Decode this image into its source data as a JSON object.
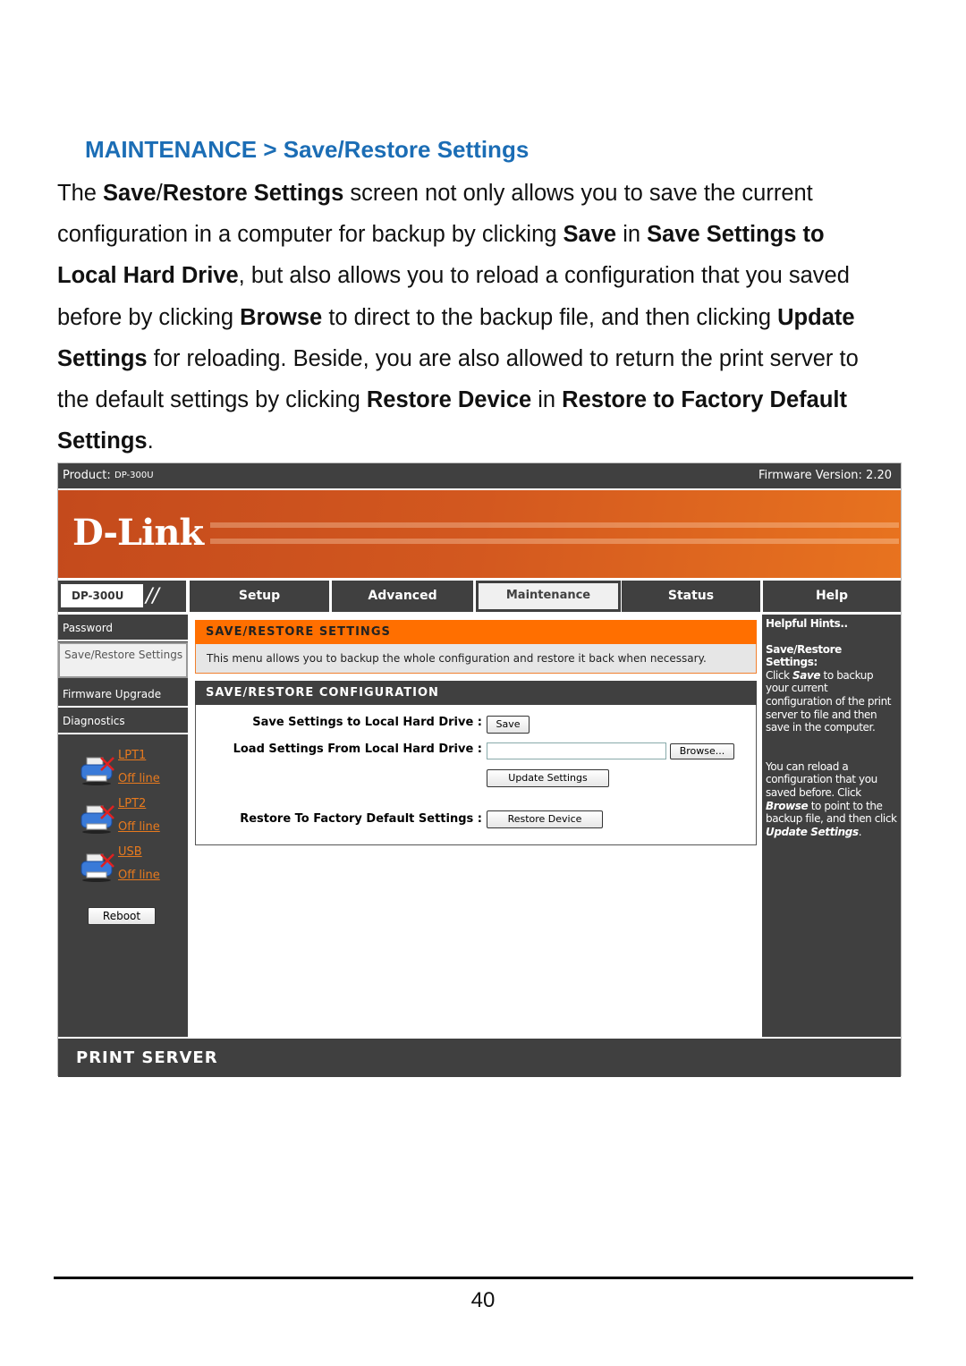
{
  "heading": "MAINTENANCE > Save/Restore Settings",
  "paragraph": [
    {
      "t": "The ",
      "b": false
    },
    {
      "t": "Save",
      "b": true
    },
    {
      "t": "/",
      "b": false
    },
    {
      "t": "Restore Settings",
      "b": true
    },
    {
      "t": " screen not only allows you to save the current configuration in a computer for backup by clicking ",
      "b": false
    },
    {
      "t": "Save",
      "b": true
    },
    {
      "t": " in ",
      "b": false
    },
    {
      "t": "Save Settings to Local Hard Drive",
      "b": true
    },
    {
      "t": ", but also allows you to reload a configuration that you saved before by clicking ",
      "b": false
    },
    {
      "t": "Browse",
      "b": true
    },
    {
      "t": " to direct to the backup file, and then clicking ",
      "b": false
    },
    {
      "t": "Update Settings",
      "b": true
    },
    {
      "t": " for reloading. Beside, you are also allowed to return the print server to the default settings by clicking ",
      "b": false
    },
    {
      "t": "Restore Device",
      "b": true
    },
    {
      "t": " in ",
      "b": false
    },
    {
      "t": "Restore to Factory Default Settings",
      "b": true
    },
    {
      "t": ".",
      "b": false
    }
  ],
  "screenshot": {
    "product_label": "Product:",
    "product": "DP-300U",
    "firmware": "Firmware Version: 2.20",
    "logo": "D-Link",
    "model_tab": "DP-300U",
    "tabs": [
      "Setup",
      "Advanced",
      "Maintenance",
      "Status",
      "Help"
    ],
    "active_tab": "Maintenance",
    "sidebar": [
      "Password",
      "Save/Restore Settings",
      "Firmware Upgrade",
      "Diagnostics"
    ],
    "ports": [
      {
        "name": "LPT1",
        "status": "Off line"
      },
      {
        "name": "LPT2",
        "status": "Off line"
      },
      {
        "name": "USB",
        "status": "Off line"
      }
    ],
    "reboot": "Reboot",
    "section1_title": "SAVE/RESTORE SETTINGS",
    "section1_desc": "This menu allows you to backup the whole configuration and restore it back when necessary.",
    "section2_title": "SAVE/RESTORE CONFIGURATION",
    "save_label": "Save Settings to Local Hard Drive :",
    "save_btn": "Save",
    "load_label": "Load Settings From Local Hard Drive :",
    "file_value": "",
    "browse_btn": "Browse...",
    "update_btn": "Update Settings",
    "restore_label": "Restore To Factory Default Settings :",
    "restore_btn": "Restore Device",
    "hints_title": "Helpful Hints..",
    "hint1_title": "Save/Restore Settings:",
    "hint1_a": "Click ",
    "hint1_b": "Save",
    "hint1_c": " to backup your current configuration of the print server to file and then save in the computer.",
    "hint2_a": "You can reload a configuration that you saved before. Click ",
    "hint2_b": "Browse",
    "hint2_c": " to point to the backup file, and then click ",
    "hint2_d": "Update Settings",
    "hint2_e": ".",
    "footer": "PRINT SERVER",
    "colors": {
      "orange": "#ff6f00",
      "dark": "#404040",
      "link": "#e87a1e",
      "heading": "#1b6db5"
    }
  },
  "page_number": "40"
}
